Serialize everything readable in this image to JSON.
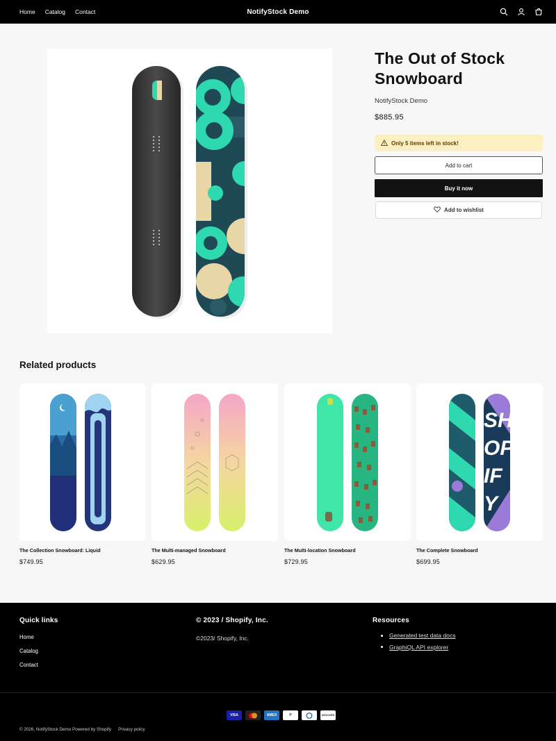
{
  "header": {
    "nav": [
      "Home",
      "Catalog",
      "Contact"
    ],
    "logo": "NotifyStock Demo",
    "icons": [
      "search-icon",
      "account-icon",
      "cart-icon"
    ]
  },
  "product": {
    "title": "The Out of Stock Snowboard",
    "vendor": "NotifyStock Demo",
    "price": "$885.95",
    "stock_notice": "Only 5 items left in stock!",
    "add_to_cart": "Add to cart",
    "buy_now": "Buy it now",
    "wishlist": "Add to wishlist"
  },
  "related": {
    "heading": "Related products",
    "items": [
      {
        "title": "The Collection Snowboard: Liquid",
        "price": "$749.95"
      },
      {
        "title": "The Multi-managed Snowboard",
        "price": "$629.95"
      },
      {
        "title": "The Multi-location Snowboard",
        "price": "$729.95"
      },
      {
        "title": "The Complete Snowboard",
        "price": "$699.95"
      }
    ]
  },
  "footer": {
    "quick_links_heading": "Quick links",
    "quick_links": [
      "Home",
      "Catalog",
      "Contact"
    ],
    "company_heading": "© 2023 / Shopify, Inc.",
    "company_text": "©2023/ Shopify, Inc.",
    "resources_heading": "Resources",
    "resources": [
      "Generated test data docs",
      "GraphiQL API explorer"
    ],
    "payment_icons": [
      "visa-icon",
      "mastercard-icon",
      "amex-icon",
      "paypal-icon",
      "diners-club-icon",
      "discover-icon"
    ],
    "payment_labels": [
      "VISA",
      "",
      "AMEX",
      "P",
      "",
      "DISCOVER"
    ],
    "copyright": "© 2026, NotifyStock Demo Powered by Shopify",
    "privacy": "Privacy policy"
  },
  "colors": {
    "accent": "#2ed9b0",
    "stock_bg": "#fcefc1",
    "header_bg": "#000000"
  }
}
